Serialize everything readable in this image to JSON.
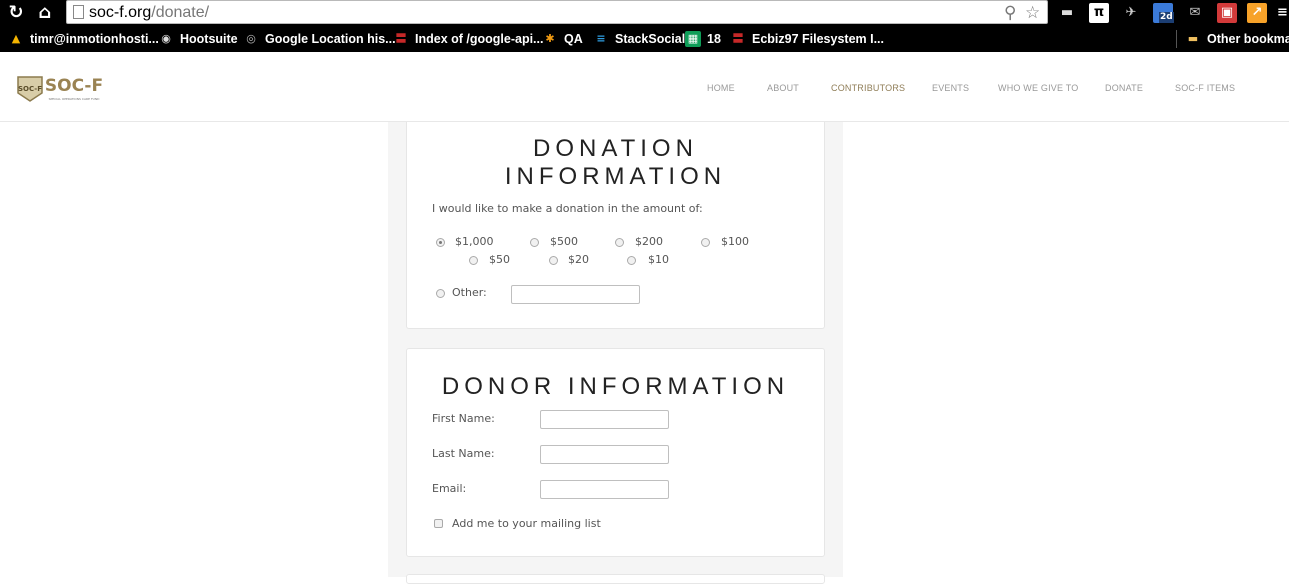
{
  "browser": {
    "url_host": "soc-f.org",
    "url_path": "/donate/",
    "extension_badge": "2d",
    "bookmarks": [
      {
        "label": "timr@inmotionhosti...",
        "icon": "drive-icon"
      },
      {
        "label": "Hootsuite",
        "icon": "owl-icon"
      },
      {
        "label": "Google Location his...",
        "icon": "location-icon"
      },
      {
        "label": "Index of /google-api...",
        "icon": "red-stripe-icon"
      },
      {
        "label": "QA",
        "icon": "joomla-icon"
      },
      {
        "label": "StackSocial",
        "icon": "stack-icon"
      },
      {
        "label": "18",
        "icon": "sheets-icon"
      },
      {
        "label": "Ecbiz97 Filesystem I...",
        "icon": "red-stripe-icon"
      }
    ],
    "other_bookmarks": "Other bookmar"
  },
  "site": {
    "logo_text": "SOC-F",
    "logo_subtext": "SPECIAL OPERATIONS CARE FUND",
    "nav": [
      "HOME",
      "ABOUT",
      "CONTRIBUTORS",
      "EVENTS",
      "WHO WE GIVE TO",
      "DONATE",
      "SOC-F ITEMS"
    ],
    "active_nav": "CONTRIBUTORS"
  },
  "donation": {
    "title_line1": "DONATION",
    "title_line2": "INFORMATION",
    "prompt": "I would like to make a donation in the amount of:",
    "amounts": [
      "$1,000",
      "$500",
      "$200",
      "$100",
      "$50",
      "$20",
      "$10"
    ],
    "selected": "$1,000",
    "other_label": "Other:",
    "other_value": ""
  },
  "donor": {
    "title": "DONOR INFORMATION",
    "first_name_label": "First Name:",
    "last_name_label": "Last Name:",
    "email_label": "Email:",
    "first_name_value": "",
    "last_name_value": "",
    "email_value": "",
    "mailing_list_label": "Add me to your mailing list",
    "mailing_list_checked": false
  }
}
